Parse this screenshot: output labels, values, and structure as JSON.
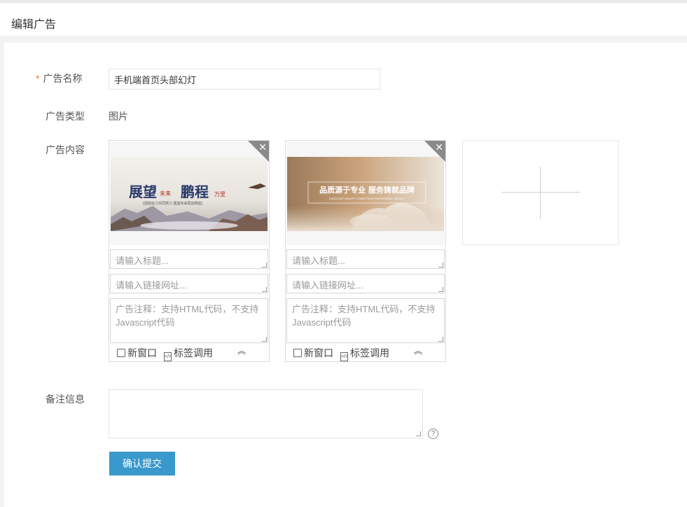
{
  "header": {
    "title": "编辑广告"
  },
  "form": {
    "name_label": "广告名称",
    "required_mark": "*",
    "name_value": "手机端首页头部幻灯",
    "type_label": "广告类型",
    "type_value": "图片",
    "content_label": "广告内容",
    "remark_label": "备注信息",
    "submit_label": "确认提交"
  },
  "cards": [
    {
      "image": {
        "line1_a": "展望",
        "line1_b": "未来",
        "line1_c": "鹏程",
        "line1_d": "万里",
        "subtitle": "[团结协力共同努力 展望未来再创辉煌]"
      },
      "title_placeholder": "请输入标题...",
      "link_placeholder": "请输入链接网址...",
      "note_placeholder": "广告注释：支持HTML代码，不支持Javascript代码",
      "new_window_label": "新窗口",
      "tag_call_label": "标签调用",
      "collapse_icon": "chevron-double-up-icon"
    },
    {
      "image": {
        "headline": "品质源于专业 服务铸就品牌",
        "subline": "EXCELLENT QUALITY COMES FROM PROFESSIONAL SERVICE"
      },
      "title_placeholder": "请输入标题...",
      "link_placeholder": "请输入链接网址...",
      "note_placeholder": "广告注释：支持HTML代码，不支持Javascript代码",
      "new_window_label": "新窗口",
      "tag_call_label": "标签调用",
      "collapse_icon": "chevron-double-up-icon"
    }
  ],
  "colors": {
    "accent": "#3998cc",
    "required": "#e8832e"
  }
}
